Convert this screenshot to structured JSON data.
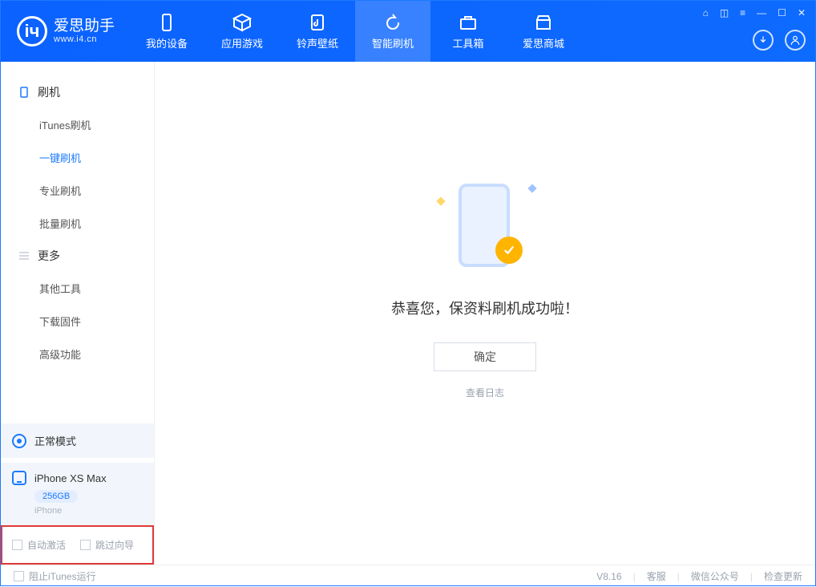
{
  "app": {
    "name": "爱思助手",
    "url": "www.i4.cn"
  },
  "nav": {
    "tabs": [
      {
        "label": "我的设备",
        "icon": "device"
      },
      {
        "label": "应用游戏",
        "icon": "cube"
      },
      {
        "label": "铃声壁纸",
        "icon": "music"
      },
      {
        "label": "智能刷机",
        "icon": "refresh"
      },
      {
        "label": "工具箱",
        "icon": "toolbox"
      },
      {
        "label": "爱思商城",
        "icon": "store"
      }
    ],
    "active_index": 3
  },
  "sidebar": {
    "groups": [
      {
        "title": "刷机",
        "icon": "phone",
        "items": [
          "iTunes刷机",
          "一键刷机",
          "专业刷机",
          "批量刷机"
        ],
        "active_index": 1
      },
      {
        "title": "更多",
        "icon": "more",
        "items": [
          "其他工具",
          "下载固件",
          "高级功能"
        ],
        "active_index": -1
      }
    ],
    "mode_label": "正常模式",
    "device": {
      "name": "iPhone XS Max",
      "size": "256GB",
      "type": "iPhone"
    },
    "options": {
      "auto_activate": "自动激活",
      "skip_wizard": "跳过向导"
    }
  },
  "main": {
    "success_text": "恭喜您，保资料刷机成功啦！",
    "ok_label": "确定",
    "log_link": "查看日志"
  },
  "footer": {
    "block_itunes": "阻止iTunes运行",
    "version": "V8.16",
    "links": [
      "客服",
      "微信公众号",
      "检查更新"
    ]
  }
}
